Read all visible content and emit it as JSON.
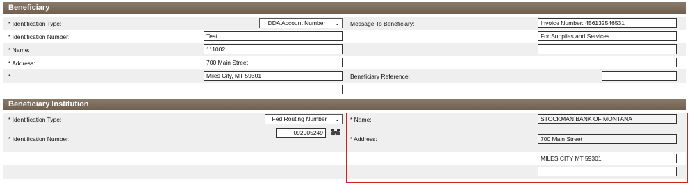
{
  "beneficiary": {
    "header": "Beneficiary",
    "id_type_label": "* Identification Type:",
    "id_type_value": "DDA Account Number",
    "id_number_label": "* Identification Number:",
    "id_number_value": "Test",
    "name_label": "* Name:",
    "name_value": "111002",
    "address_label": "* Address:",
    "address_value": "700 Main Street",
    "address2_label": "*",
    "address2_value": "Miles City, MT 59301",
    "address3_value": "",
    "message_label": "Message To Beneficiary:",
    "message_lines": [
      "Invoice Number: 456132546531",
      "For Supplies and Services",
      "",
      ""
    ],
    "reference_label": "Beneficiary Reference:",
    "reference_value": ""
  },
  "institution": {
    "header": "Beneficiary Institution",
    "id_type_label": "* Identification Type:",
    "id_type_value": "Fed Routing Number",
    "id_number_label": "* Identification Number:",
    "id_number_value": "092905249",
    "name_label": "* Name:",
    "name_value": "STOCKMAN BANK OF MONTANA",
    "address_label": "* Address:",
    "address_lines": [
      "700 Main Street",
      "MILES CITY MT 59301",
      ""
    ]
  },
  "icons": {
    "lookup": "binoculars-icon",
    "dropdown": "chevron-down-icon"
  },
  "colors": {
    "header_bg": "#7b6b5b",
    "highlight_border": "#cc2222",
    "row_alt": "#efefef"
  }
}
